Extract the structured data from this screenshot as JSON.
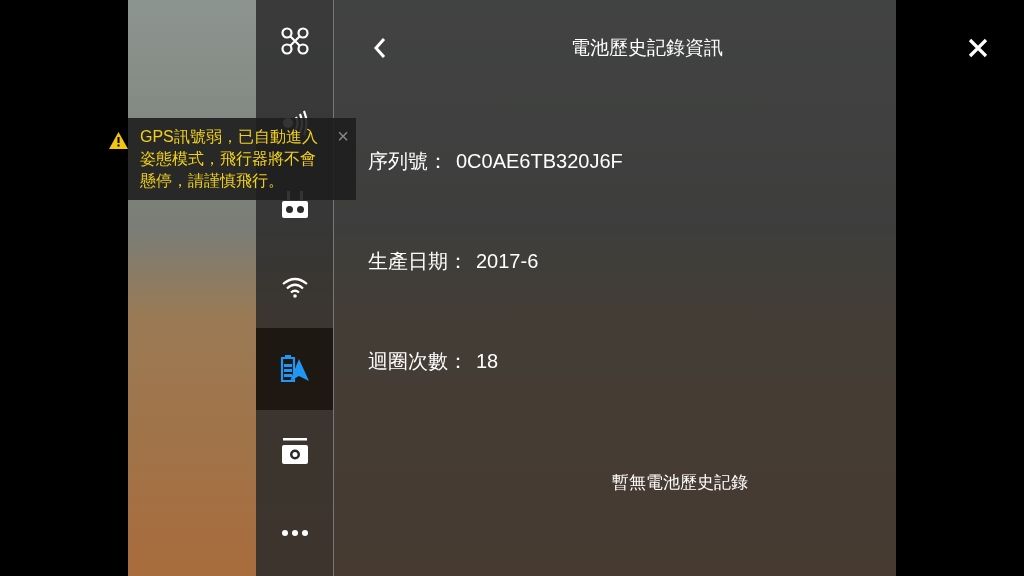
{
  "warning_toast": {
    "text": "GPS訊號弱，已自動進入姿態模式，飛行器將不會懸停，請謹慎飛行。",
    "close": "×"
  },
  "sidebar": {
    "items": [
      {
        "kind": "drone",
        "selected": false
      },
      {
        "kind": "signal",
        "selected": false
      },
      {
        "kind": "remote",
        "selected": false
      },
      {
        "kind": "wifi",
        "selected": false
      },
      {
        "kind": "battery",
        "selected": true
      },
      {
        "kind": "camera",
        "selected": false
      },
      {
        "kind": "more",
        "selected": false
      }
    ]
  },
  "panel": {
    "title": "電池歷史記錄資訊",
    "fields": [
      {
        "label": "序列號：",
        "value": "0C0AE6TB320J6F"
      },
      {
        "label": "生產日期：",
        "value": "2017-6"
      },
      {
        "label": "迴圈次數：",
        "value": "18"
      }
    ],
    "empty_message": "暫無電池歷史記錄"
  }
}
